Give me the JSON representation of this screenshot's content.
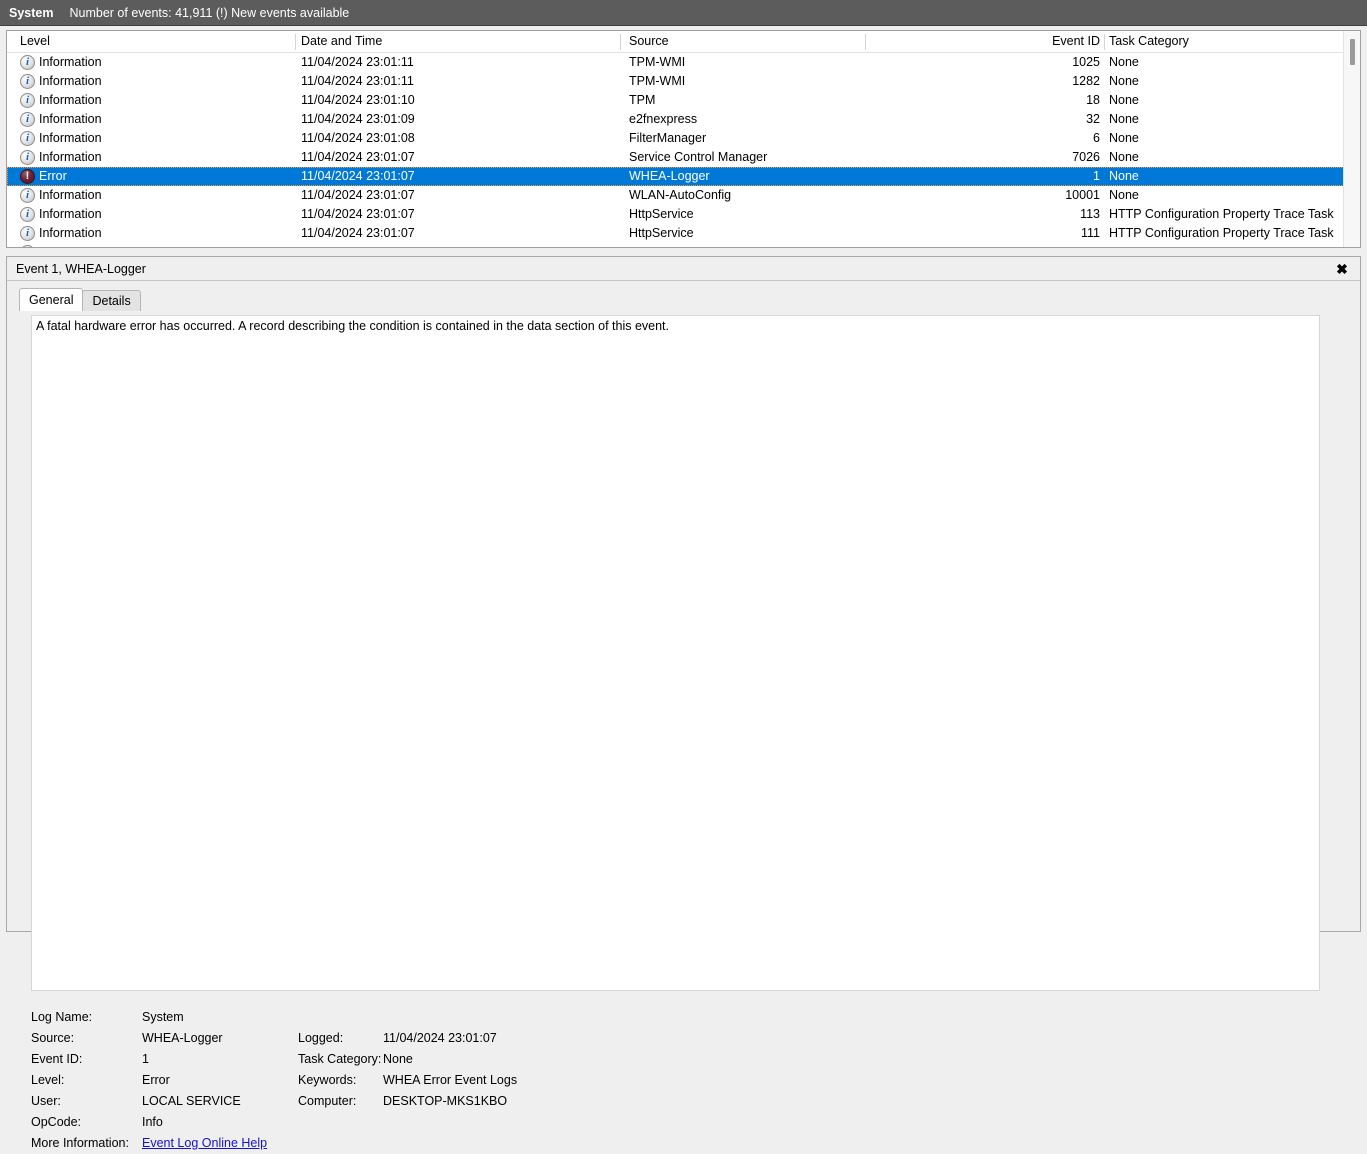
{
  "status_bar": {
    "log_name": "System",
    "info": "Number of events: 41,911 (!) New events available"
  },
  "events_grid": {
    "columns": [
      {
        "key": "level",
        "label": "Level"
      },
      {
        "key": "date",
        "label": "Date and Time"
      },
      {
        "key": "source",
        "label": "Source"
      },
      {
        "key": "eid",
        "label": "Event ID"
      },
      {
        "key": "task",
        "label": "Task Category"
      }
    ],
    "rows": [
      {
        "icon": "information-icon",
        "level": "Information",
        "date": "11/04/2024 23:01:11",
        "source": "TPM-WMI",
        "eid": "1025",
        "task": "None",
        "selected": false
      },
      {
        "icon": "information-icon",
        "level": "Information",
        "date": "11/04/2024 23:01:11",
        "source": "TPM-WMI",
        "eid": "1282",
        "task": "None",
        "selected": false
      },
      {
        "icon": "information-icon",
        "level": "Information",
        "date": "11/04/2024 23:01:10",
        "source": "TPM",
        "eid": "18",
        "task": "None",
        "selected": false
      },
      {
        "icon": "information-icon",
        "level": "Information",
        "date": "11/04/2024 23:01:09",
        "source": "e2fnexpress",
        "eid": "32",
        "task": "None",
        "selected": false
      },
      {
        "icon": "information-icon",
        "level": "Information",
        "date": "11/04/2024 23:01:08",
        "source": "FilterManager",
        "eid": "6",
        "task": "None",
        "selected": false
      },
      {
        "icon": "information-icon",
        "level": "Information",
        "date": "11/04/2024 23:01:07",
        "source": "Service Control Manager",
        "eid": "7026",
        "task": "None",
        "selected": false
      },
      {
        "icon": "error-icon",
        "level": "Error",
        "date": "11/04/2024 23:01:07",
        "source": "WHEA-Logger",
        "eid": "1",
        "task": "None",
        "selected": true
      },
      {
        "icon": "information-icon",
        "level": "Information",
        "date": "11/04/2024 23:01:07",
        "source": "WLAN-AutoConfig",
        "eid": "10001",
        "task": "None",
        "selected": false
      },
      {
        "icon": "information-icon",
        "level": "Information",
        "date": "11/04/2024 23:01:07",
        "source": "HttpService",
        "eid": "113",
        "task": "HTTP Configuration Property Trace Task",
        "selected": false
      },
      {
        "icon": "information-icon",
        "level": "Information",
        "date": "11/04/2024 23:01:07",
        "source": "HttpService",
        "eid": "111",
        "task": "HTTP Configuration Property Trace Task",
        "selected": false
      }
    ]
  },
  "detail": {
    "title": "Event 1, WHEA-Logger",
    "close_label": "✖",
    "tabs": [
      {
        "label": "General",
        "active": true
      },
      {
        "label": "Details",
        "active": false
      }
    ],
    "description": "A fatal hardware error has occurred. A record describing the condition is contained in the data section of this event.",
    "meta": {
      "log_name_label": "Log Name:",
      "log_name_value": "System",
      "source_label": "Source:",
      "source_value": "WHEA-Logger",
      "logged_label": "Logged:",
      "logged_value": "11/04/2024 23:01:07",
      "event_id_label": "Event ID:",
      "event_id_value": "1",
      "task_category_label": "Task Category:",
      "task_category_value": "None",
      "level_label": "Level:",
      "level_value": "Error",
      "keywords_label": "Keywords:",
      "keywords_value": "WHEA Error Event Logs",
      "user_label": "User:",
      "user_value": "LOCAL SERVICE",
      "computer_label": "Computer:",
      "computer_value": "DESKTOP-MKS1KBO",
      "opcode_label": "OpCode:",
      "opcode_value": "Info",
      "more_info_label": "More Information:",
      "more_info_link": "Event Log Online Help"
    }
  },
  "colors": {
    "selection": "#0078d7",
    "status_bar_bg": "#5c5c5c",
    "link": "#1414c8",
    "error_icon": "#6e2338",
    "info_icon": "#1565c0"
  }
}
